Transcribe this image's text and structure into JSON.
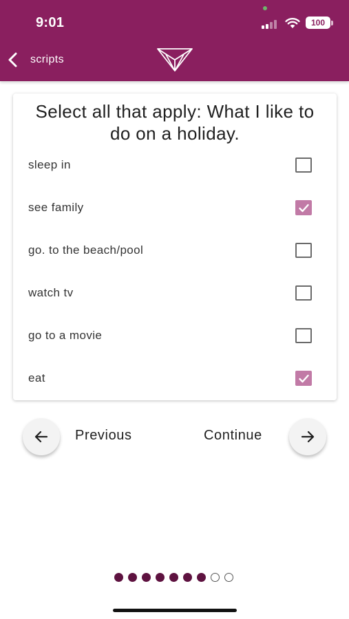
{
  "status_bar": {
    "time": "9:01",
    "battery": "100"
  },
  "nav": {
    "back_label": "scripts"
  },
  "question": "Select all that apply: What I like to do on a holiday.",
  "options": [
    {
      "label": "sleep in",
      "checked": false
    },
    {
      "label": "see family",
      "checked": true
    },
    {
      "label": "go. to the beach/pool",
      "checked": false
    },
    {
      "label": "watch tv",
      "checked": false
    },
    {
      "label": "go to a movie",
      "checked": false
    },
    {
      "label": "eat",
      "checked": true
    }
  ],
  "navigation": {
    "previous_label": "Previous",
    "continue_label": "Continue"
  },
  "progress": {
    "completed": 7,
    "total": 9
  },
  "colors": {
    "brand": "#8a1f5f",
    "checkbox_checked": "#c17aa6",
    "dot_filled": "#5e1240"
  }
}
